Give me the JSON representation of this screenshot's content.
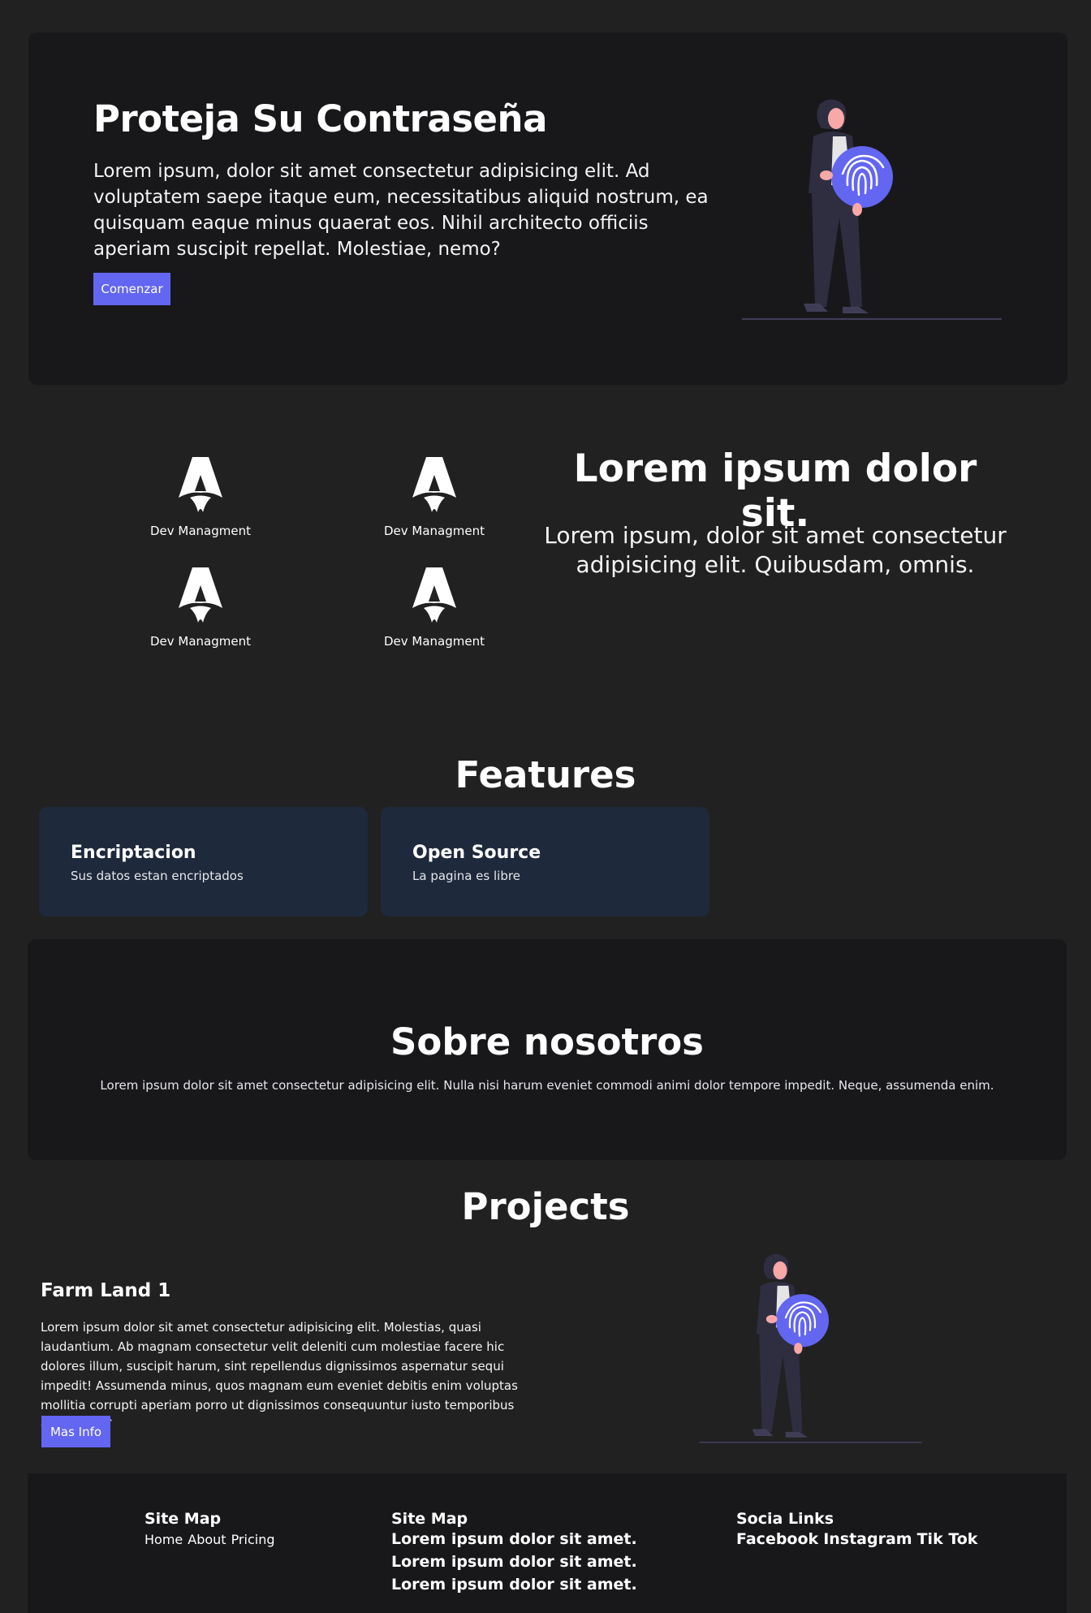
{
  "hero": {
    "title": "Proteja Su Contraseña",
    "text": "Lorem ipsum, dolor sit amet consectetur adipisicing elit. Ad voluptatem saepe itaque eum, necessitatibus aliquid nostrum, ea quisquam eaque minus quaerat eos. Nihil architecto officiis aperiam suscipit repellat. Molestiae, nemo?",
    "button": "Comenzar"
  },
  "devs": {
    "items": [
      {
        "label": "Dev Managment"
      },
      {
        "label": "Dev Managment"
      },
      {
        "label": "Dev Managment"
      },
      {
        "label": "Dev Managment"
      }
    ],
    "icon": "rocket-logo-icon"
  },
  "intro": {
    "title": "Lorem ipsum dolor sit.",
    "text": "Lorem ipsum, dolor sit amet consectetur adipisicing elit. Quibusdam, omnis."
  },
  "features": {
    "title": "Features",
    "cards": [
      {
        "title": "Encriptacion",
        "desc": "Sus datos estan encriptados"
      },
      {
        "title": "Open Source",
        "desc": "La pagina es libre"
      }
    ]
  },
  "about": {
    "title": "Sobre nosotros",
    "text": "Lorem ipsum dolor sit amet consectetur adipisicing elit. Nulla nisi harum eveniet commodi animi dolor tempore impedit. Neque, assumenda enim."
  },
  "projects": {
    "title": "Projects",
    "item": {
      "title": "Farm Land 1",
      "text": "Lorem ipsum dolor sit amet consectetur adipisicing elit. Molestias, quasi laudantium. Ab magnam consectetur velit deleniti cum molestiae facere hic dolores illum, suscipit harum, sint repellendus dignissimos aspernatur sequi impedit! Assumenda minus, quos magnam eum eveniet debitis enim voluptas mollitia corrupti aperiam porro ut dignissimos consequuntur iusto temporibus officiis nisi.`",
      "button": "Mas Info"
    }
  },
  "footer": {
    "col1": {
      "heading": "Site Map",
      "links": [
        "Home",
        "About",
        "Pricing"
      ]
    },
    "col2": {
      "heading": "Site Map",
      "lines": [
        "Lorem ipsum dolor sit amet.",
        "Lorem ipsum dolor sit amet.",
        "Lorem ipsum dolor sit amet."
      ]
    },
    "col3": {
      "heading": "Socia Links",
      "links": [
        "Facebook",
        "Instagram",
        "Tik Tok"
      ]
    }
  },
  "colors": {
    "background": "#212121",
    "panel": "#18181b",
    "card": "#1e293b",
    "accent": "#6366f1"
  }
}
